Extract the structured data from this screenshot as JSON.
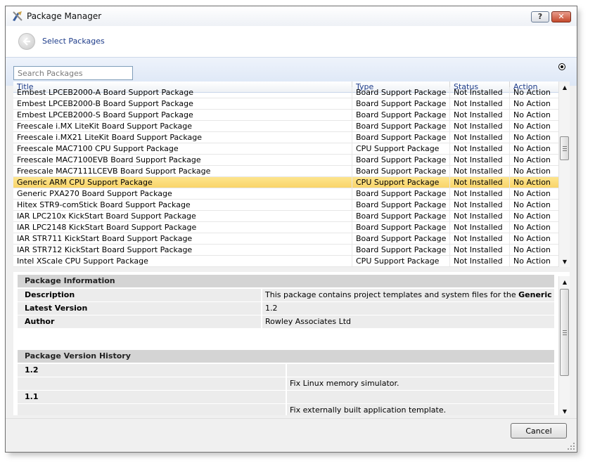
{
  "window": {
    "title": "Package Manager",
    "help_label": "?",
    "close_label": "✕"
  },
  "header": {
    "page_title": "Select Packages"
  },
  "search": {
    "placeholder": "Search Packages"
  },
  "table": {
    "columns": [
      "Title",
      "Type",
      "Status",
      "Action"
    ],
    "partial_row": [
      "Embest LPCEB2000-A Board Support Package",
      "Board Support Package",
      "Not Installed",
      "No Action"
    ],
    "rows": [
      [
        "Embest LPCEB2000-B Board Support Package",
        "Board Support Package",
        "Not Installed",
        "No Action"
      ],
      [
        "Embest LPCEB2000-S Board Support Package",
        "Board Support Package",
        "Not Installed",
        "No Action"
      ],
      [
        "Freescale i.MX LiteKit Board Support Package",
        "Board Support Package",
        "Not Installed",
        "No Action"
      ],
      [
        "Freescale i.MX21 LiteKit Board Support Package",
        "Board Support Package",
        "Not Installed",
        "No Action"
      ],
      [
        "Freescale MAC7100 CPU Support Package",
        "CPU Support Package",
        "Not Installed",
        "No Action"
      ],
      [
        "Freescale MAC7100EVB Board Support Package",
        "Board Support Package",
        "Not Installed",
        "No Action"
      ],
      [
        "Freescale MAC7111LCEVB Board Support Package",
        "Board Support Package",
        "Not Installed",
        "No Action"
      ],
      [
        "Generic ARM CPU Support Package",
        "CPU Support Package",
        "Not Installed",
        "No Action"
      ],
      [
        "Generic PXA270 Board Support Package",
        "Board Support Package",
        "Not Installed",
        "No Action"
      ],
      [
        "Hitex STR9-comStick Board Support Package",
        "Board Support Package",
        "Not Installed",
        "No Action"
      ],
      [
        "IAR LPC210x KickStart Board Support Package",
        "Board Support Package",
        "Not Installed",
        "No Action"
      ],
      [
        "IAR LPC2148 KickStart Board Support Package",
        "Board Support Package",
        "Not Installed",
        "No Action"
      ],
      [
        "IAR STR711 KickStart Board Support Package",
        "Board Support Package",
        "Not Installed",
        "No Action"
      ],
      [
        "IAR STR712 KickStart Board Support Package",
        "Board Support Package",
        "Not Installed",
        "No Action"
      ],
      [
        "Intel XScale CPU Support Package",
        "CPU Support Package",
        "Not Installed",
        "No Action"
      ]
    ],
    "selected_index": 7
  },
  "info": {
    "section_title": "Package Information",
    "description_label": "Description",
    "description_prefix": "This package contains project templates and system files for the ",
    "description_bold": "Generic ARM",
    "description_suffix": ".",
    "latest_version_label": "Latest Version",
    "latest_version": "1.2",
    "author_label": "Author",
    "author": "Rowley Associates Ltd",
    "history_title": "Package Version History",
    "history": [
      {
        "version": "1.2",
        "note": "Fix Linux memory simulator."
      },
      {
        "version": "1.1",
        "note": "Fix externally built application template."
      }
    ]
  },
  "footer": {
    "cancel_label": "Cancel"
  },
  "colors": {
    "selected_row": "#f9d469",
    "link_blue": "#1e3c8a",
    "section_gray": "#d4d4d4"
  }
}
